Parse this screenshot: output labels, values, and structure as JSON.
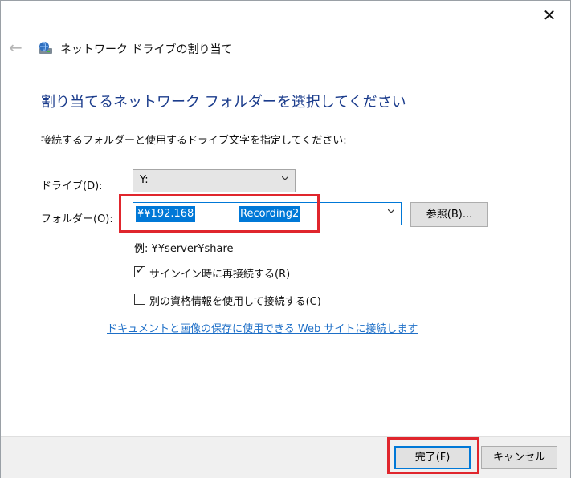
{
  "window": {
    "title": "ネットワーク ドライブの割り当て",
    "heading": "割り当てるネットワーク フォルダーを選択してください",
    "instruction": "接続するフォルダーと使用するドライブ文字を指定してください:"
  },
  "drive": {
    "label": "ドライブ(D):",
    "value": "Y:"
  },
  "folder": {
    "label": "フォルダー(O):",
    "value_part1": "¥¥192.168",
    "value_part2": "Recording2",
    "browse_label": "参照(B)...",
    "example": "例: ¥¥server¥share"
  },
  "options": {
    "reconnect_label": "サインイン時に再接続する(R)",
    "reconnect_checked": true,
    "other_creds_label": "別の資格情報を使用して接続する(C)",
    "other_creds_checked": false
  },
  "link": {
    "text": "ドキュメントと画像の保存に使用できる Web サイトに接続します"
  },
  "buttons": {
    "finish": "完了(F)",
    "cancel": "キャンセル"
  },
  "icons": {
    "close": "close-icon",
    "back": "back-arrow-icon",
    "app": "network-drive-icon",
    "dropdown": "chevron-down-icon"
  },
  "colors": {
    "heading": "#1b3c8c",
    "accent": "#0078d7",
    "highlight_box": "#e0262d",
    "link": "#1e6fc7"
  }
}
